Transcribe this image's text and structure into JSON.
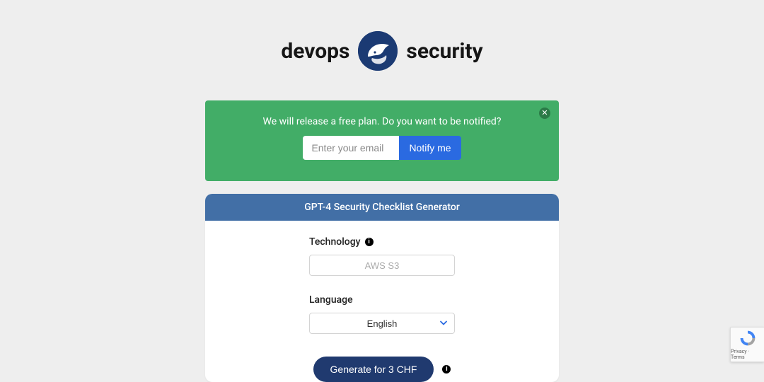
{
  "brand": {
    "left_word": "devops",
    "right_word": "security"
  },
  "notify": {
    "text": "We will release a free plan. Do you want to be notified?",
    "email_placeholder": "Enter your email",
    "button_label": "Notify me"
  },
  "card": {
    "title": "GPT-4 Security Checklist Generator",
    "technology": {
      "label": "Technology",
      "placeholder": "AWS S3",
      "value": ""
    },
    "language": {
      "label": "Language",
      "selected": "English"
    },
    "generate_label": "Generate for 3 CHF"
  },
  "recaptcha": {
    "footer": "Privacy · Terms"
  }
}
